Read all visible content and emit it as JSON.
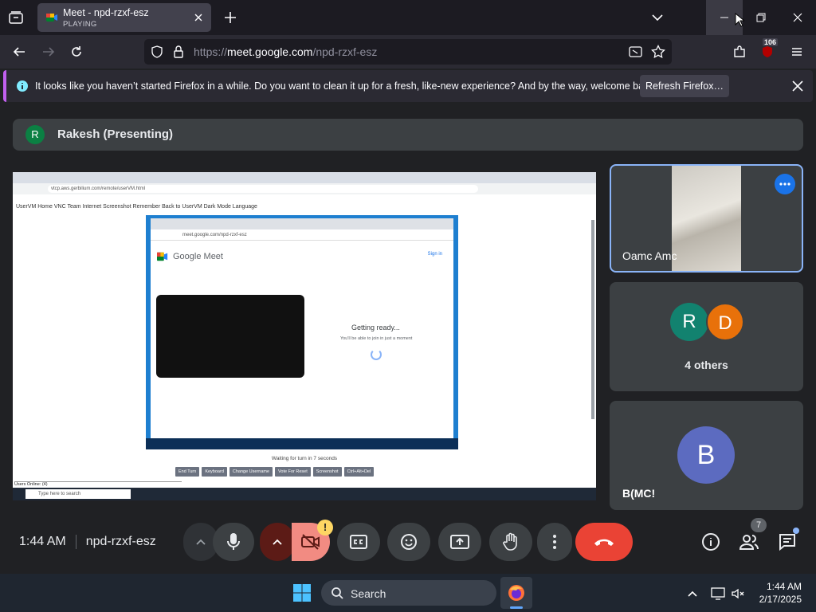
{
  "browser": {
    "tab": {
      "title": "Meet - npd-rzxf-esz",
      "status": "PLAYING"
    },
    "url": {
      "prefix": "https://",
      "host": "meet.google.com",
      "path": "/npd-rzxf-esz"
    },
    "extension_badge": "106",
    "notification": {
      "message": "It looks like you haven’t started Firefox in a while. Do you want to clean it up for a fresh, like-new experience? And by the way, welcome back!",
      "button": "Refresh Firefox…"
    }
  },
  "meet": {
    "presenter": {
      "initial": "R",
      "label": "Rakesh (Presenting)"
    },
    "shared_screen": {
      "address": "vtcp.aws.gerbilium.com/remote/userVM.html",
      "bookmarks": "UserVM   Home   VNC   Team   Internet   Screenshot   Remember   Back to UserVM   Dark Mode   Language",
      "inner_address": "meet.google.com/npd-rzxf-esz",
      "meet_title": "Google Meet",
      "sign_in": "Sign in",
      "ready": "Getting ready...",
      "ready_sub": "You'll be able to join in just a moment",
      "waiting": "Waiting for turn in 7 seconds",
      "buttons": [
        "End Turn",
        "Keyboard",
        "Change Username",
        "Vote For Reset",
        "Screenshot",
        "Ctrl+Alt+Del"
      ],
      "users_online": "Users Online: (4)",
      "search": "Type here to search"
    },
    "tiles": [
      {
        "label": "Oamc Amc"
      },
      {
        "initials": [
          "R",
          "D"
        ],
        "label": "4 others"
      },
      {
        "initial": "B",
        "label": "B(MC!"
      }
    ],
    "controls": {
      "time": "1:44 AM",
      "code": "npd-rzxf-esz",
      "camera_warning": "!",
      "people_count": "7"
    }
  },
  "taskbar": {
    "search": "Search",
    "time": "1:44 AM",
    "date": "2/17/2025"
  },
  "colors": {
    "meet_bg": "#202124",
    "tile_bg": "#3c4043",
    "end_call": "#ea4335",
    "camera_off": "#f28b82",
    "active_tile_border": "#8ab4f8"
  }
}
